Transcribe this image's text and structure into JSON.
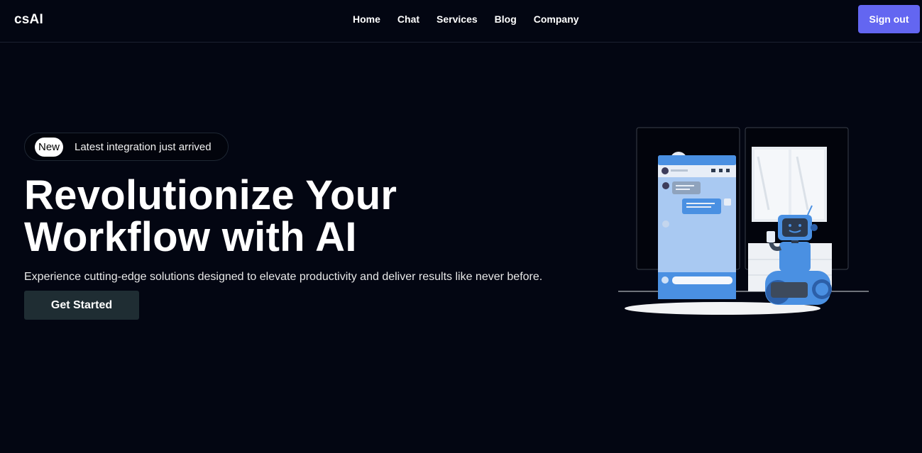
{
  "header": {
    "brand": "csAI",
    "nav": [
      "Home",
      "Chat",
      "Services",
      "Blog",
      "Company"
    ],
    "signout_label": "Sign out"
  },
  "hero": {
    "badge_pill": "New",
    "badge_text": "Latest integration just arrived",
    "headline_line1": "Revolutionize Your",
    "headline_line2": "Workflow with AI",
    "subtext": "Experience cutting-edge solutions designed to elevate productivity and deliver results like never before.",
    "cta_label": "Get Started"
  },
  "colors": {
    "background": "#030612",
    "accent": "#6366f1",
    "cta": "#1f2d33",
    "illustration_blue": "#4a90e2"
  },
  "icons": {
    "illustration": "robot-chat-illustration"
  }
}
